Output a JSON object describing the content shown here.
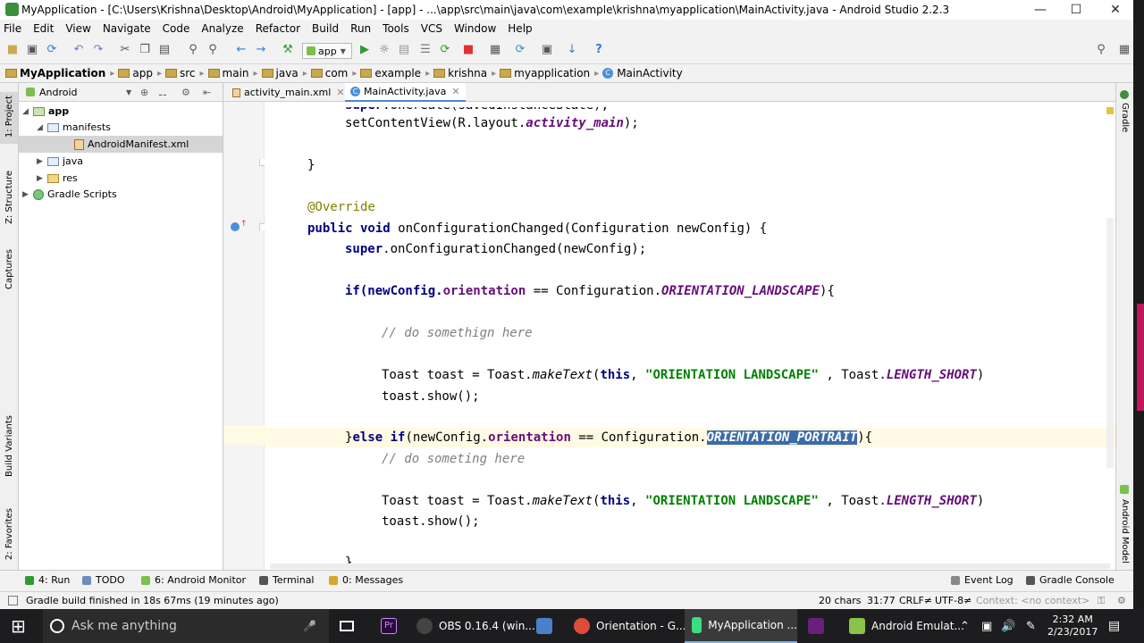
{
  "window": {
    "title": "MyApplication - [C:\\Users\\Krishna\\Desktop\\Android\\MyApplication] - [app] - ...\\app\\src\\main\\java\\com\\example\\krishna\\myapplication\\MainActivity.java - Android Studio 2.2.3",
    "minimize": "—",
    "maximize": "☐",
    "close": "✕"
  },
  "menu": [
    "File",
    "Edit",
    "View",
    "Navigate",
    "Code",
    "Analyze",
    "Refactor",
    "Build",
    "Run",
    "Tools",
    "VCS",
    "Window",
    "Help"
  ],
  "toolbar": {
    "run_config": "app",
    "help_icon": "?"
  },
  "breadcrumbs": [
    "MyApplication",
    "app",
    "src",
    "main",
    "java",
    "com",
    "example",
    "krishna",
    "myapplication",
    "MainActivity"
  ],
  "project_panel": {
    "view_selector": "Android",
    "tree": [
      {
        "label": "app",
        "icon": "module-folder",
        "expanded": true
      },
      {
        "label": "manifests",
        "icon": "folder",
        "expanded": true
      },
      {
        "label": "AndroidManifest.xml",
        "icon": "xml-file",
        "selected": true
      },
      {
        "label": "java",
        "icon": "folder",
        "expanded": false
      },
      {
        "label": "res",
        "icon": "folder",
        "expanded": false
      },
      {
        "label": "Gradle Scripts",
        "icon": "gradle",
        "expanded": false
      }
    ]
  },
  "side_tabs_left": [
    "1: Project",
    "Z: Structure",
    "Captures",
    "Build Variants",
    "2: Favorites"
  ],
  "side_tabs_right": [
    "Gradle",
    "Android Model"
  ],
  "editor_tabs": [
    {
      "label": "activity_main.xml",
      "active": false,
      "close": "✕"
    },
    {
      "label": "MainActivity.java",
      "active": true,
      "close": "✕"
    }
  ],
  "code": {
    "l1_a": "setContentView(R.layout.",
    "l1_b": "activity_main",
    "l1_c": ");",
    "l2": "}",
    "l3": "@Override",
    "l4_kw": "public void",
    "l4_rest": " onConfigurationChanged(Configuration newConfig) {",
    "l5_kw": "super",
    "l5_rest": ".onConfigurationChanged(newConfig);",
    "l6_a": "if(newConfig.",
    "l6_b": "orientation",
    "l6_c": " == Configuration.",
    "l6_d": "ORIENTATION_LANDSCAPE",
    "l6_e": "){",
    "l7": "// do somethign here",
    "l8_a": "Toast toast = Toast.",
    "l8_b": "makeText",
    "l8_c": "(",
    "l8_kw": "this",
    "l8_d": ", ",
    "l8_str": "\"ORIENTATION LANDSCAPE\"",
    "l8_e": " , Toast.",
    "l8_f": "LENGTH_SHORT",
    "l8_g": ")",
    "l9": "toast.show();",
    "l10_a": "}",
    "l10_kw": "else if",
    "l10_b": "(newConfig.",
    "l10_c": "orientation",
    "l10_d": " == Configuration.",
    "l10_e": "ORIENTATION_PORTRAIT",
    "l10_f": "){",
    "l11": "// do someting here",
    "l12_a": "Toast toast = Toast.",
    "l12_b": "makeText",
    "l12_c": "(",
    "l12_kw": "this",
    "l12_d": ", ",
    "l12_str": "\"ORIENTATION LANDSCAPE\"",
    "l12_e": " , Toast.",
    "l12_f": "LENGTH_SHORT",
    "l12_g": ")",
    "l13": "toast.show();",
    "l14": "}"
  },
  "bottom_tools": {
    "run": "4: Run",
    "todo": "TODO",
    "monitor": "6: Android Monitor",
    "terminal": "Terminal",
    "messages": "0: Messages",
    "event_log": "Event Log",
    "gradle_console": "Gradle Console"
  },
  "status": {
    "message": "Gradle build finished in 18s 67ms (19 minutes ago)",
    "chars": "20 chars",
    "position": "31:77",
    "line_sep": "CRLF≠",
    "encoding": "UTF-8≠",
    "context": "Context: <no context>"
  },
  "taskbar": {
    "search": "Ask me anything",
    "items": [
      {
        "label": "OBS 0.16.4 (win...",
        "color": "#444"
      },
      {
        "label": "Orientation - G...",
        "color": "#dd4b39"
      },
      {
        "label": "MyApplication ...",
        "color": "#3ddc84",
        "active": true
      },
      {
        "label": "Android Emulat...",
        "color": "#8bc34a"
      }
    ],
    "time": "2:32 AM",
    "date": "2/23/2017"
  },
  "colors": {
    "keyword": "#000080",
    "field": "#660e7a",
    "string": "#008000",
    "comment": "#808080",
    "annotation": "#808000",
    "selection": "#3c6ca8"
  }
}
